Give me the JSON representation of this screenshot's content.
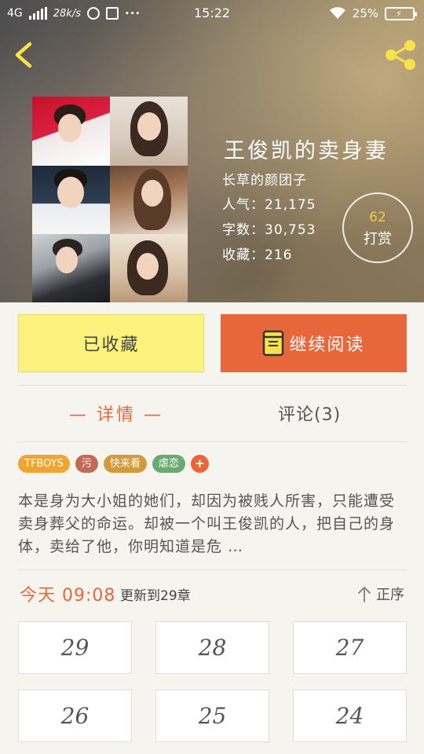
{
  "status_bar": {
    "network": "4G",
    "speed": "28k/s",
    "more": "···",
    "time": "15:22",
    "battery": "25%"
  },
  "book": {
    "title": "王俊凯的卖身妻",
    "author": "长草的颜团子",
    "popularity": "人气：21,175",
    "word_count": "字数：30,753",
    "favorites": "收藏：216"
  },
  "reward": {
    "count": "62",
    "label": "打赏"
  },
  "actions": {
    "favorited_label": "已收藏",
    "continue_label": "继续阅读"
  },
  "tabs": {
    "details": "— 详情 —",
    "comments": "评论(3)"
  },
  "tags": [
    {
      "label": "TFBOYS",
      "color": "#f0a531"
    },
    {
      "label": "污",
      "color": "#c26a55"
    },
    {
      "label": "快来看",
      "color": "#d39a3b"
    },
    {
      "label": "虐恋",
      "color": "#6aa96f"
    },
    {
      "label": "+",
      "color": "#e8673a"
    }
  ],
  "synopsis": "本是身为大小姐的她们，却因为被贱人所害，只能遭受卖身葬父的命运。却被一个叫王俊凯的人，把自己的身体，卖给了他，你明知道是危 …",
  "update": {
    "time": "今天 09:08",
    "text": "更新到29章",
    "sort_label": "正序"
  },
  "chapters": [
    "29",
    "28",
    "27",
    "26",
    "25",
    "24"
  ],
  "colors": {
    "accent": "#e8673a",
    "favorite_bg": "#fbf37e",
    "icon_yellow": "#f7e24a"
  }
}
